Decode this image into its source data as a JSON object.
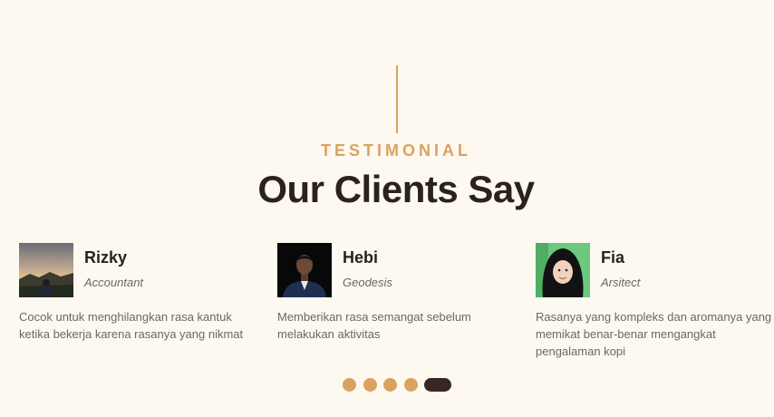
{
  "section": {
    "eyebrow": "TESTIMONIAL",
    "title": "Our Clients Say"
  },
  "testimonials": [
    {
      "name": "Rizky",
      "role": "Accountant",
      "text": "Cocok untuk menghilangkan rasa kantuk ketika bekerja karena rasanya yang nikmat",
      "avatar_icon": "person-sunset-photo"
    },
    {
      "name": "Hebi",
      "role": "Geodesis",
      "text": "Memberikan rasa semangat sebelum melakukan aktivitas",
      "avatar_icon": "person-suit-photo"
    },
    {
      "name": "Fia",
      "role": "Arsitect",
      "text": "Rasanya yang kompleks dan aromanya yang memikat benar-benar mengangkat pengalaman kopi",
      "avatar_icon": "person-hijab-photo"
    }
  ],
  "carousel": {
    "total_slides": 5,
    "active_index": 4
  },
  "colors": {
    "background": "#fdf9f0",
    "accent": "#d9a35f",
    "heading": "#2b2220",
    "body_text": "#6f6661",
    "active_dot": "#3a2623"
  }
}
